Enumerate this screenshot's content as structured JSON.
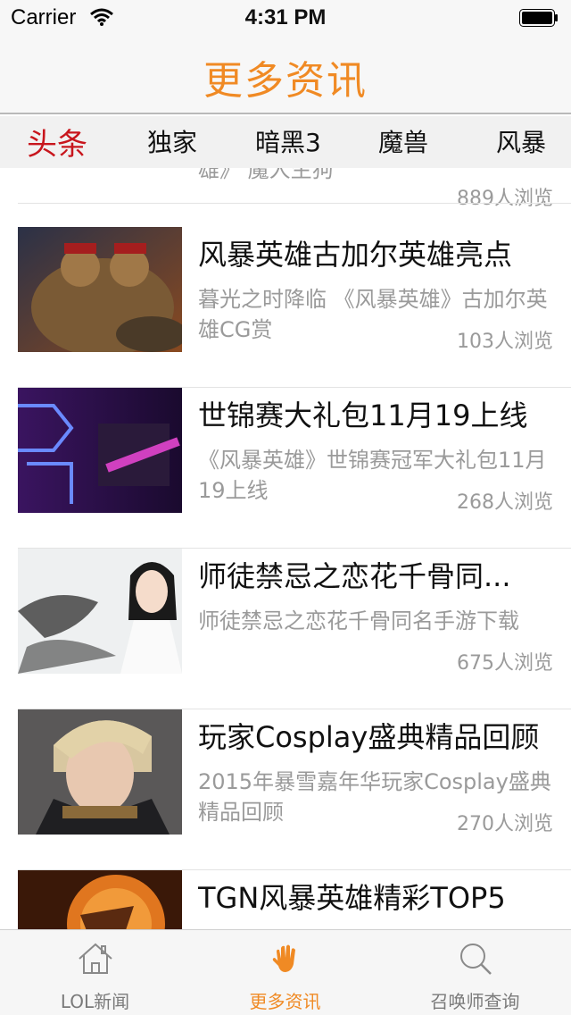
{
  "status": {
    "carrier": "Carrier",
    "time": "4:31 PM"
  },
  "nav": {
    "title": "更多资讯"
  },
  "categories": [
    "头条",
    "独家",
    "暗黑3",
    "魔兽",
    "风暴"
  ],
  "partial_item": {
    "desc_tail": "雄》 魔人生狗",
    "views": "889人浏览"
  },
  "news": [
    {
      "title": "风暴英雄古加尔英雄亮点",
      "desc": "暮光之时降临 《风暴英雄》古加尔英雄CG赏",
      "views": "103人浏览"
    },
    {
      "title": "世锦赛大礼包11月19上线",
      "desc": "《风暴英雄》世锦赛冠军大礼包11月19上线",
      "views": "268人浏览"
    },
    {
      "title": "师徒禁忌之恋花千骨同...",
      "desc": "师徒禁忌之恋花千骨同名手游下载",
      "views": "675人浏览"
    },
    {
      "title": "玩家Cosplay盛典精品回顾",
      "desc": "2015年暴雪嘉年华玩家Cosplay盛典精品回顾",
      "views": "270人浏览"
    },
    {
      "title": "TGN风暴英雄精彩TOP5",
      "desc": "",
      "views": ""
    }
  ],
  "tabs": [
    {
      "label": "LOL新闻",
      "icon": "home-icon"
    },
    {
      "label": "更多资讯",
      "icon": "hand-icon"
    },
    {
      "label": "召唤师查询",
      "icon": "search-icon"
    }
  ],
  "colors": {
    "accent": "#f08a24",
    "category_active": "#c8161d",
    "secondary_text": "#9a9a9a"
  }
}
